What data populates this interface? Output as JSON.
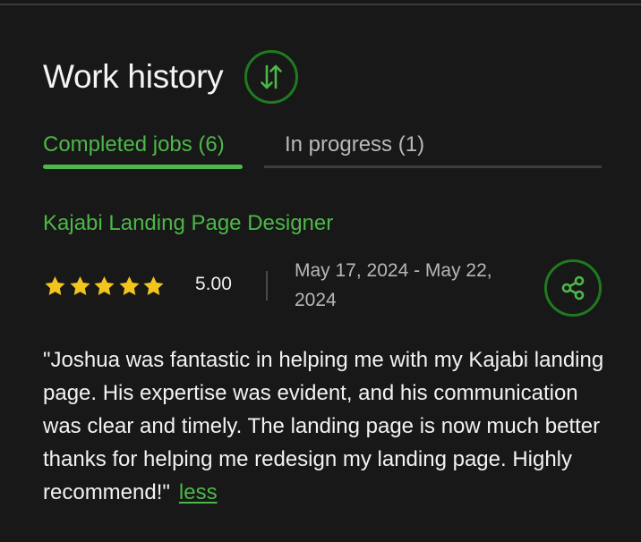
{
  "section": {
    "title": "Work history",
    "sort_icon": "sort-arrows-icon"
  },
  "tabs": [
    {
      "label": "Completed jobs (6)",
      "active": true
    },
    {
      "label": "In progress (1)",
      "active": false
    }
  ],
  "job": {
    "title": "Kajabi Landing Page Designer",
    "rating": 5,
    "rating_max": 5,
    "rating_label": "5.00",
    "date_range": "May 17, 2024 - May 22, 2024",
    "share_icon": "share-icon",
    "review": "\"Joshua was fantastic in helping me with my Kajabi landing page. His expertise was evident, and his communication was clear and timely. The landing page is now much better thanks for helping me redesign my landing page. Highly recommend!\"",
    "less_label": "less"
  },
  "colors": {
    "background": "#181818",
    "accent": "#4cb848",
    "accent_dark": "#1f7a1f",
    "star": "#f2c51d",
    "muted_text": "#b7b7b7"
  }
}
